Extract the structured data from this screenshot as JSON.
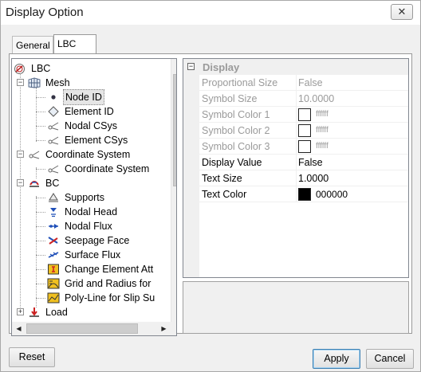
{
  "window": {
    "title": "Display Option",
    "close_glyph": "✕"
  },
  "tabs": [
    {
      "label": "General",
      "active": false
    },
    {
      "label": "LBC",
      "active": true
    }
  ],
  "tree": {
    "root": {
      "label": "LBC",
      "icon": "lbc-icon"
    },
    "nodes": [
      {
        "label": "Mesh",
        "icon": "mesh-icon",
        "expanded": true,
        "children": [
          {
            "label": "Node ID",
            "icon": "node-dot-icon",
            "selected": true
          },
          {
            "label": "Element ID",
            "icon": "diamond-icon"
          },
          {
            "label": "Nodal CSys",
            "icon": "csys-icon"
          },
          {
            "label": "Element CSys",
            "icon": "csys-icon"
          }
        ]
      },
      {
        "label": "Coordinate System",
        "icon": "csys-icon",
        "expanded": true,
        "children": [
          {
            "label": "Coordinate System",
            "icon": "csys-icon"
          }
        ]
      },
      {
        "label": "BC",
        "icon": "bc-icon",
        "expanded": true,
        "children": [
          {
            "label": "Supports",
            "icon": "supports-icon"
          },
          {
            "label": "Nodal Head",
            "icon": "nodal-head-icon"
          },
          {
            "label": "Nodal Flux",
            "icon": "nodal-flux-icon"
          },
          {
            "label": "Seepage Face",
            "icon": "seepage-face-icon"
          },
          {
            "label": "Surface Flux",
            "icon": "surface-flux-icon"
          },
          {
            "label": "Change Element Att",
            "icon": "change-element-icon"
          },
          {
            "label": "Grid and Radius for",
            "icon": "grid-radius-icon"
          },
          {
            "label": "Poly-Line for Slip Su",
            "icon": "polyline-icon"
          }
        ]
      },
      {
        "label": "Load",
        "icon": "load-icon",
        "expanded": false
      }
    ]
  },
  "properties": {
    "category": "Display",
    "rows": [
      {
        "name": "Proportional Size",
        "value": "False",
        "enabled": false
      },
      {
        "name": "Symbol Size",
        "value": "10.0000",
        "enabled": false
      },
      {
        "name": "Symbol Color 1",
        "value": "ffffff",
        "color": "#ffffff",
        "enabled": false
      },
      {
        "name": "Symbol Color 2",
        "value": "ffffff",
        "color": "#ffffff",
        "enabled": false
      },
      {
        "name": "Symbol Color 3",
        "value": "ffffff",
        "color": "#ffffff",
        "enabled": false
      },
      {
        "name": "Display Value",
        "value": "False",
        "enabled": true
      },
      {
        "name": "Text Size",
        "value": "1.0000",
        "enabled": true
      },
      {
        "name": "Text Color",
        "value": "000000",
        "color": "#000000",
        "enabled": true
      }
    ]
  },
  "buttons": {
    "reset": "Reset",
    "apply": "Apply",
    "cancel": "Cancel"
  },
  "colors": {
    "selection_border": "#3c7fb1",
    "disabled_text": "#9a9a9a",
    "tab_border": "#999999"
  }
}
